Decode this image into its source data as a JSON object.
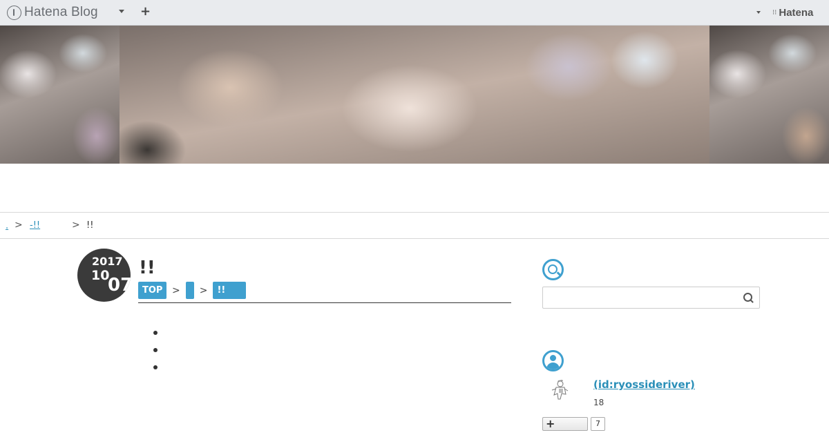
{
  "topbar": {
    "logo_text": "Hatena Blog",
    "plus_label": "+",
    "hatena_text": "Hatena"
  },
  "breadcrumb": {
    "home": ".",
    "sep": ">",
    "category": "-!!",
    "current": "!!"
  },
  "entry": {
    "date": {
      "year": "2017",
      "month": "10",
      "day": "07"
    },
    "title": "!!",
    "categories": [
      "TOP",
      "",
      "!!"
    ],
    "toc_items": [
      "",
      "",
      ""
    ]
  },
  "sidebar": {
    "search": {
      "placeholder": ""
    },
    "profile": {
      "name": " (id:ryossideriver)",
      "age": "18",
      "follow_label": "+",
      "follow_count": "7"
    }
  },
  "colors": {
    "accent": "#3fa0cf",
    "link": "#2a8fb8",
    "date_circle": "#3a3a3a"
  }
}
